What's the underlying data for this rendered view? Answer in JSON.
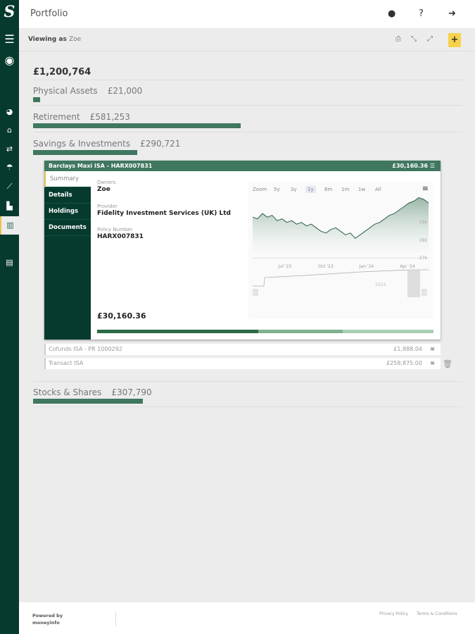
{
  "header": {
    "title": "Portfolio"
  },
  "subheader": {
    "viewing_label": "Viewing as",
    "viewing_user": "Zoe",
    "add_label": "+"
  },
  "portfolio": {
    "total": "£1,200,764",
    "categories": [
      {
        "name": "Physical Assets",
        "amount": "£21,000",
        "fraction": 0.017
      },
      {
        "name": "Retirement",
        "amount": "£581,253",
        "fraction": 0.484
      },
      {
        "name": "Savings & Investments",
        "amount": "£290,721",
        "fraction": 0.242
      },
      {
        "name": "Stocks & Shares",
        "amount": "£307,790",
        "fraction": 0.256
      }
    ]
  },
  "card": {
    "title": "Barclays Maxi ISA - HARX007831",
    "value": "£30,160.36",
    "tabs": [
      "Summary",
      "Details",
      "Holdings",
      "Documents"
    ],
    "owners_label": "Owners",
    "owners": "Zoe",
    "provider_label": "Provider",
    "provider": "Fidelity Investment Services (UK) Ltd",
    "policy_label": "Policy Number",
    "policy": "HARX007831",
    "balance": "£30,160.36",
    "progress": [
      0.48,
      0.25,
      0.27
    ]
  },
  "chart_data": {
    "type": "area",
    "range_label": "Zoom",
    "ranges": [
      "5y",
      "3y",
      "1y",
      "6m",
      "1m",
      "1w",
      "All"
    ],
    "selected_range": "1y",
    "xticks": [
      "Jul '23",
      "Oct '23",
      "Jan '24",
      "Apr '24"
    ],
    "yticks": [
      "27k",
      "28k",
      "29k"
    ],
    "navigator_label": "2023",
    "values": [
      29.3,
      29.2,
      29.5,
      29.3,
      29.4,
      29.1,
      29.2,
      29.0,
      29.1,
      28.9,
      29.0,
      28.8,
      28.9,
      28.7,
      28.5,
      28.4,
      28.6,
      28.7,
      28.5,
      28.3,
      28.4,
      28.1,
      28.3,
      28.5,
      28.7,
      28.9,
      29.0,
      29.2,
      29.4,
      29.5,
      29.7,
      29.9,
      30.1,
      30.2,
      30.4,
      30.3,
      30.1
    ]
  },
  "accounts": [
    {
      "name": "Cofunds ISA - PR 1000292",
      "value": "£1,888.04"
    },
    {
      "name": "Transact ISA",
      "value": "£258,875.00"
    }
  ],
  "footer": {
    "powered": "Powered by",
    "brand": "moneyinfo",
    "privacy": "Privacy Policy",
    "terms": "Terms & Conditions"
  }
}
